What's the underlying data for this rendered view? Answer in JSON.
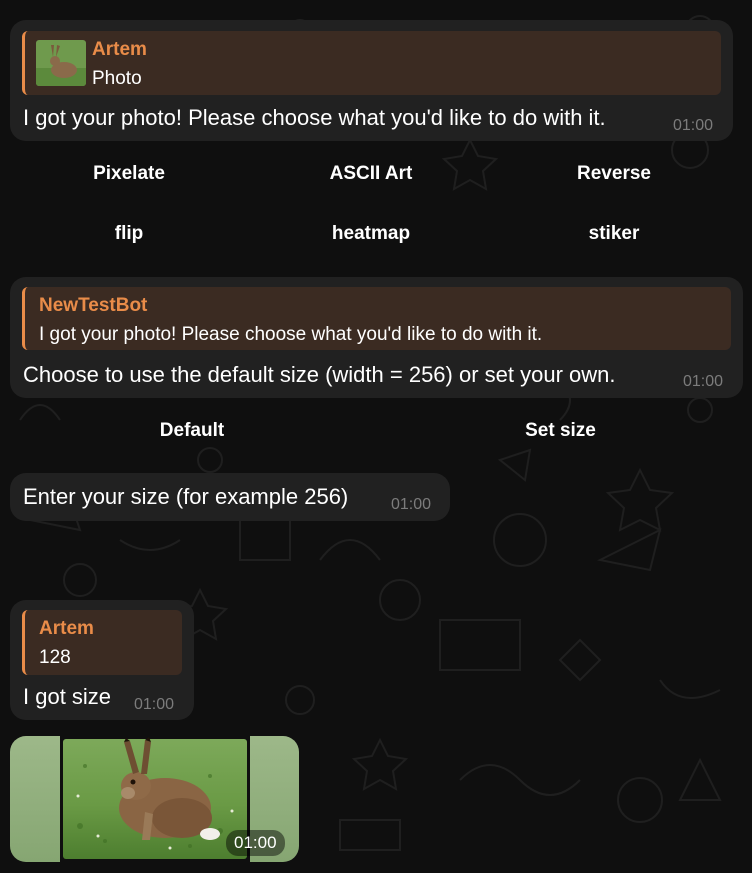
{
  "messages": [
    {
      "reply_name": "Artem",
      "reply_text": "Photo",
      "text": "I got your photo! Please choose what you'd like to do with it.",
      "time": "01:00"
    },
    {
      "reply_name": "NewTestBot",
      "reply_text": "I got your photo! Please choose what you'd like to do with it.",
      "text": "Choose to use the default size (width = 256) or set your own.",
      "time": "01:00"
    },
    {
      "text": "Enter your size (for example 256)",
      "time": "01:00"
    },
    {
      "reply_name": "Artem",
      "reply_text": "128",
      "text": "I got size",
      "time": "01:00"
    },
    {
      "time": "01:00"
    }
  ],
  "keyboard1": [
    "Pixelate",
    "ASCII Art",
    "Reverse",
    "flip",
    "heatmap",
    "stiker"
  ],
  "keyboard2": [
    "Default",
    "Set size"
  ],
  "colors": {
    "background": "#0f0f0f",
    "bubble": "#212121",
    "reply_bg": "#3b2b22",
    "accent": "#e98c49",
    "time": "#7c7c7c"
  }
}
